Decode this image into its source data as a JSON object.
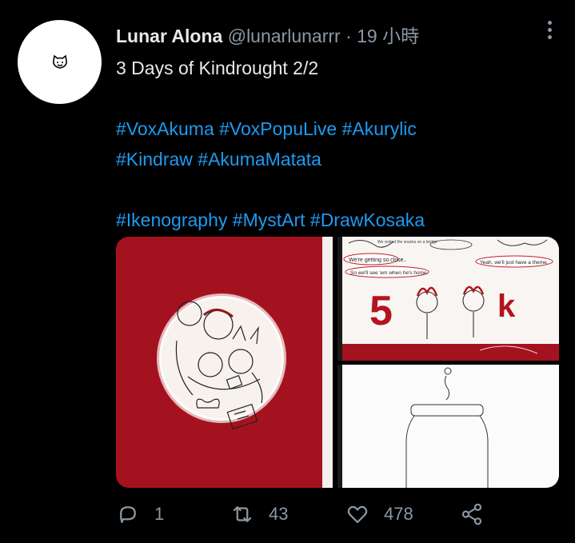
{
  "user": {
    "display_name": "Lunar Alona",
    "handle": "@lunarlunarrr",
    "time": "19 小時"
  },
  "tweet": {
    "text": "3 Days of Kindrought 2/2",
    "hashtags_line1": [
      "#VoxAkuma",
      "#VoxPopuLive",
      "#Akurylic"
    ],
    "hashtags_line2": [
      "#Kindraw",
      "#AkumaMatata"
    ],
    "hashtags_line3": [
      "#Ikenography",
      "#MystArt",
      "#DrawKosaka"
    ]
  },
  "media": {
    "comic_bubbles": {
      "b1": "We're getting so close..",
      "b2": "So we'll see 'em when he's home.",
      "b3": "Yeah, we'll just have a theme.",
      "number": "5",
      "k": "k"
    }
  },
  "actions": {
    "reply_count": "1",
    "retweet_count": "43",
    "like_count": "478"
  },
  "icons": {
    "avatar": "cat-face-icon",
    "more": "more-dots-icon",
    "reply": "reply-icon",
    "retweet": "retweet-icon",
    "like": "heart-icon",
    "share": "share-icon"
  },
  "colors": {
    "background": "#000000",
    "hashtag": "#1d9bf0",
    "muted": "#8b98a5",
    "art_red": "#a5121f"
  }
}
